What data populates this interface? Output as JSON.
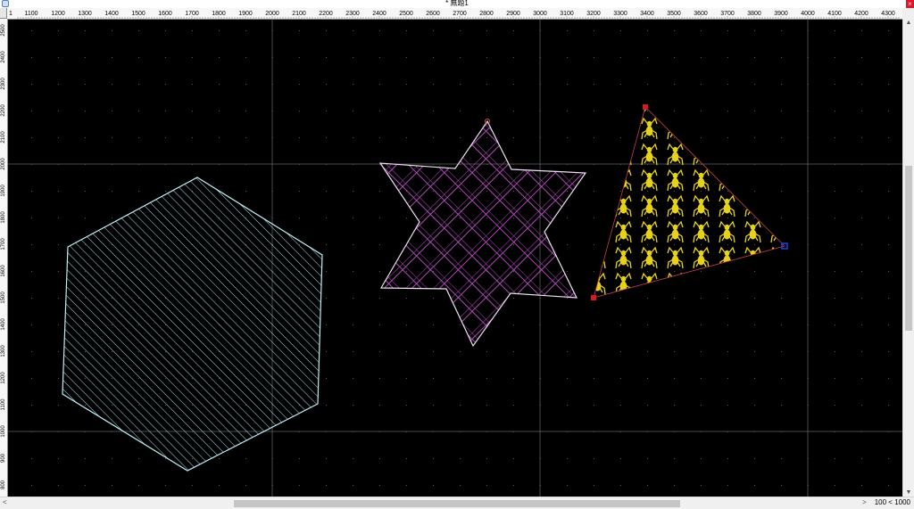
{
  "window": {
    "title": "* 無題1",
    "close_glyph": "×"
  },
  "ruler": {
    "x_labels": [
      "1100",
      "1200",
      "1300",
      "1400",
      "1500",
      "1600",
      "1700",
      "1800",
      "1900",
      "2000",
      "2100",
      "2200",
      "2300",
      "2400",
      "2500",
      "2600",
      "2700",
      "2800",
      "2900",
      "3000",
      "3100",
      "3200",
      "3300",
      "3400",
      "3500",
      "3600",
      "3700",
      "3800",
      "3900",
      "4000",
      "4100",
      "4200",
      "4300"
    ],
    "y_labels": [
      "2500",
      "2400",
      "2300",
      "2200",
      "2100",
      "2000",
      "1900",
      "1800",
      "1700",
      "1600",
      "1500",
      "1400",
      "1300",
      "1200",
      "1100",
      "1000",
      "900",
      "800"
    ]
  },
  "status": {
    "zoom": "100 < 1000"
  },
  "scrollbars": {
    "left_arrow": "<",
    "right_arrow": ">",
    "up_arrow": "▲",
    "down_arrow": "▼"
  },
  "shapes": [
    {
      "name": "hexagon",
      "hatch": "diagonal lines",
      "color": "#a8e4ee"
    },
    {
      "name": "star",
      "hatch": "crosshatch",
      "color": "#b04ab8"
    },
    {
      "name": "triangle",
      "hatch": "spider pattern",
      "color": "#e6d21a"
    }
  ],
  "colors": {
    "canvas": "#000000",
    "grid_dot": "#5a5a5a",
    "selection_handle_red": "#d01c24",
    "selection_handle_blue": "#2040e0"
  }
}
